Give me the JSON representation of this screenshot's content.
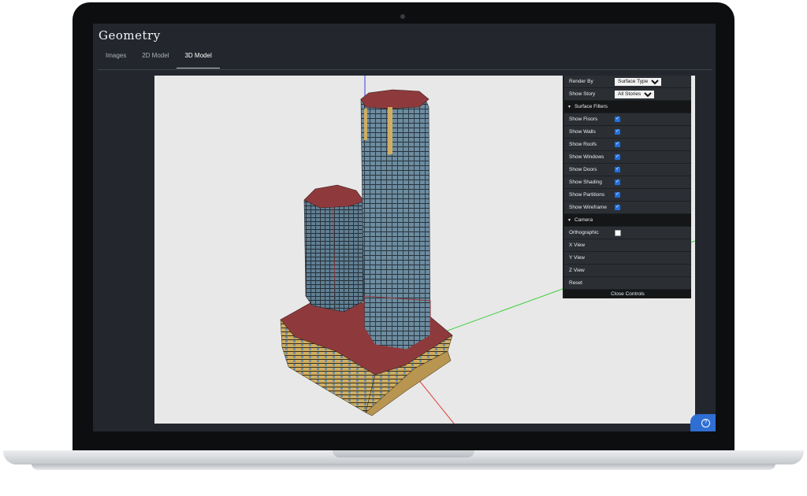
{
  "app": {
    "title": "Geometry"
  },
  "tabs": [
    {
      "label": "Images",
      "active": false
    },
    {
      "label": "2D Model",
      "active": false
    },
    {
      "label": "3D Model",
      "active": true
    }
  ],
  "controls": {
    "render_by": {
      "label": "Render By",
      "value": "Surface Type"
    },
    "show_story": {
      "label": "Show Story",
      "value": "All Stories"
    },
    "surface_filters": {
      "title": "Surface Filters",
      "items": [
        {
          "label": "Show Floors",
          "checked": true
        },
        {
          "label": "Show Walls",
          "checked": true
        },
        {
          "label": "Show Roofs",
          "checked": true
        },
        {
          "label": "Show Windows",
          "checked": true
        },
        {
          "label": "Show Doors",
          "checked": true
        },
        {
          "label": "Show Shading",
          "checked": true
        },
        {
          "label": "Show Partitions",
          "checked": true
        },
        {
          "label": "Show Wireframe",
          "checked": true
        }
      ]
    },
    "camera": {
      "title": "Camera",
      "orthographic": {
        "label": "Orthographic",
        "checked": false
      },
      "x_view": "X View",
      "y_view": "Y View",
      "z_view": "Z View",
      "reset": "Reset"
    },
    "close_label": "Close Controls"
  },
  "help": {
    "icon": "help-icon"
  },
  "colors": {
    "roof": "#8e3a3c",
    "window": "#6f8fa3",
    "wall": "#c9a962",
    "axis_x": "#e0403a",
    "axis_y": "#3ccf3c",
    "axis_z": "#3a3ae0"
  }
}
